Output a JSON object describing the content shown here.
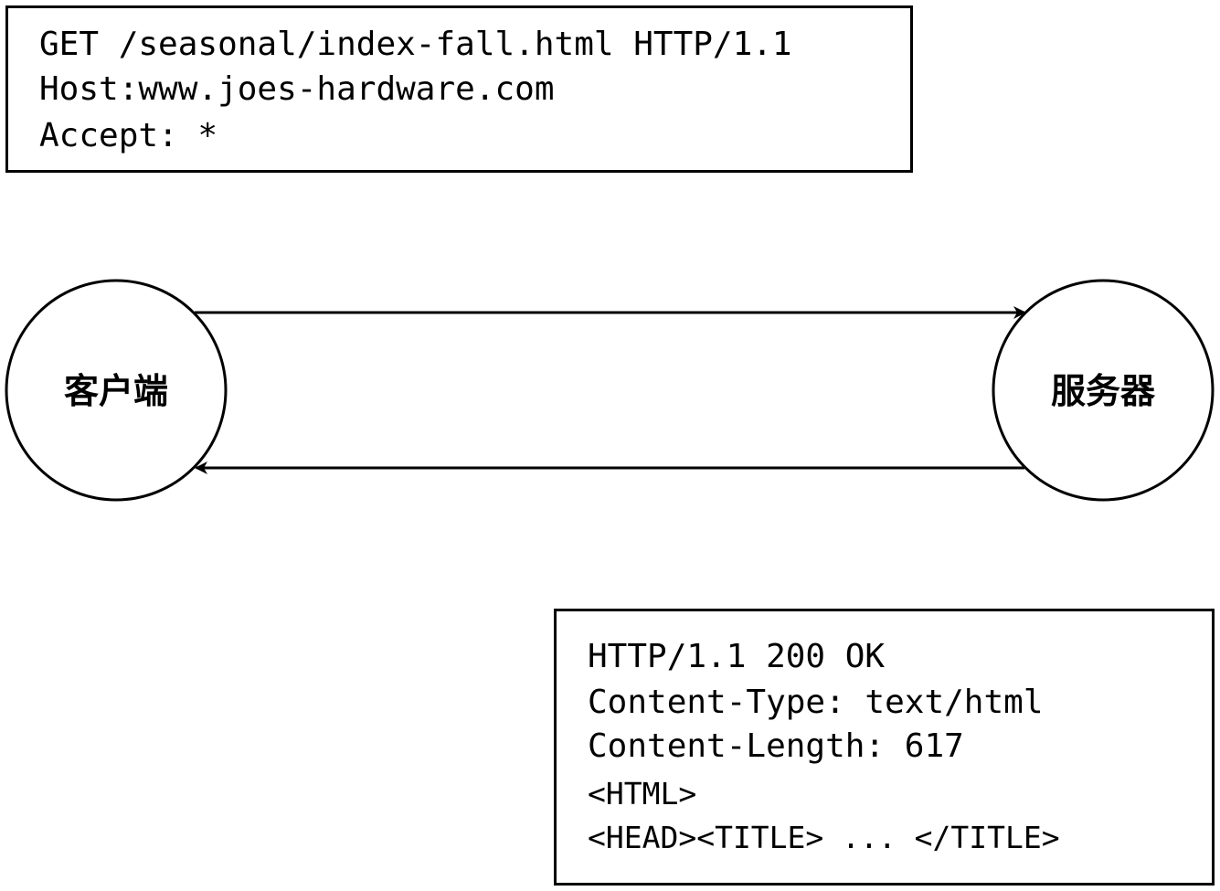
{
  "request": {
    "lines": [
      "GET /seasonal/index-fall.html HTTP/1.1",
      "Host:www.joes-hardware.com",
      "Accept: *"
    ]
  },
  "client": {
    "label": "客户端"
  },
  "server": {
    "label": "服务器"
  },
  "response": {
    "lines": [
      "HTTP/1.1 200 OK",
      "Content-Type: text/html",
      "Content-Length: 617",
      "<HTML>",
      "<HEAD><TITLE> ... </TITLE>"
    ]
  },
  "colors": {
    "stroke": "#000000",
    "background": "#ffffff"
  }
}
